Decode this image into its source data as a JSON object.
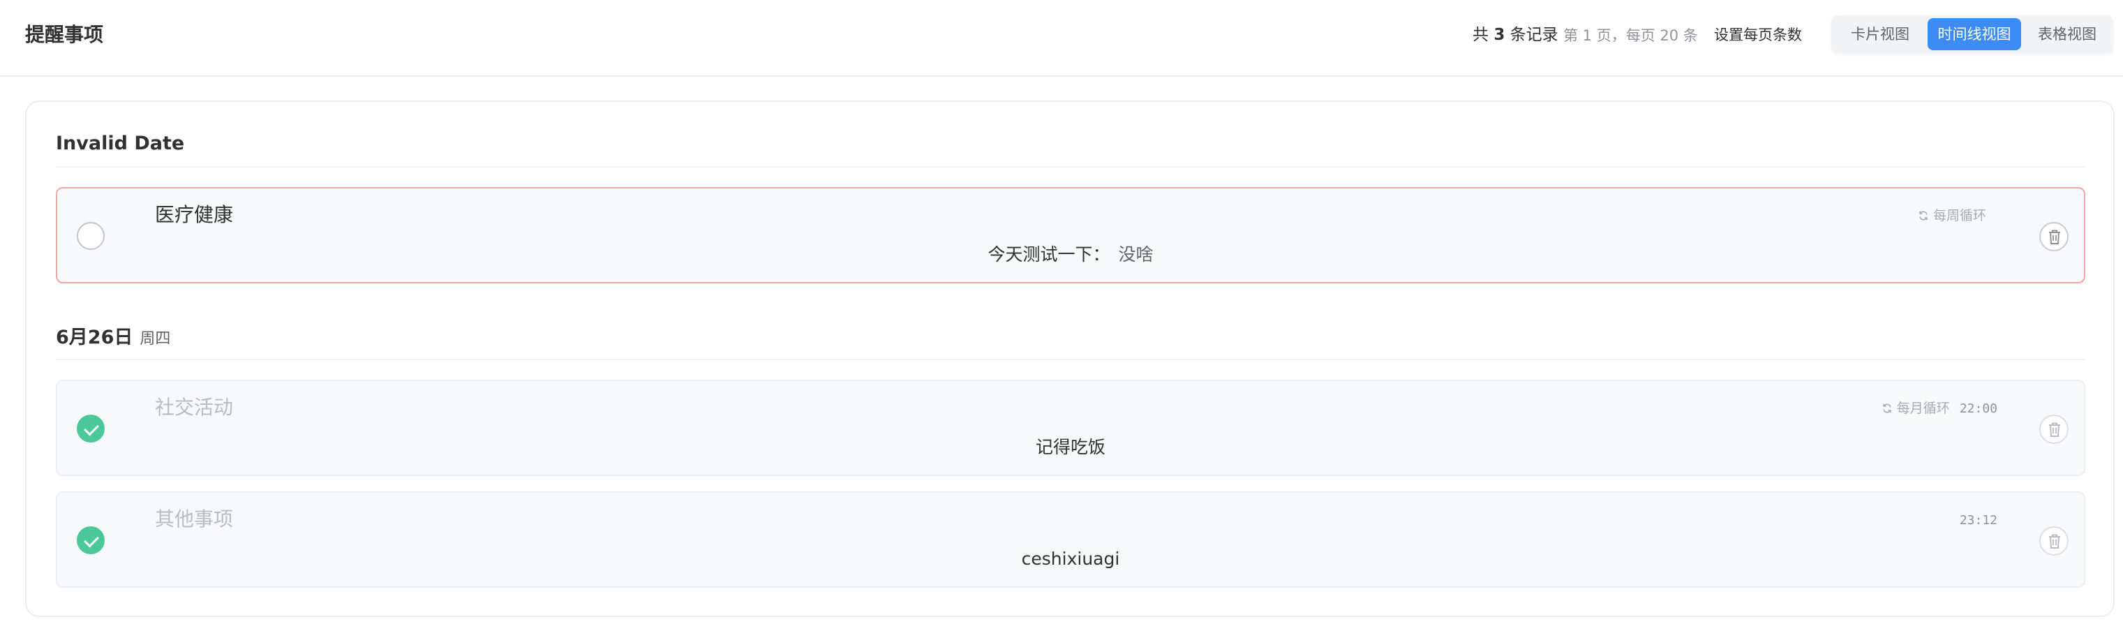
{
  "header": {
    "title": "提醒事项",
    "count_prefix": "共 ",
    "count_num": "3",
    "count_suffix": " 条记录",
    "pager_info": "第 1 页，每页 20 条",
    "set_page_size": "设置每页条数",
    "views": [
      {
        "label": "卡片视图",
        "active": false
      },
      {
        "label": "时间线视图",
        "active": true
      },
      {
        "label": "表格视图",
        "active": false
      }
    ]
  },
  "groups": [
    {
      "date": "Invalid Date",
      "weekday": "",
      "items": [
        {
          "title": "医疗健康",
          "desc_label": "今天测试一下：",
          "desc_value": "没啥",
          "repeat": "每周循环",
          "time": "",
          "completed": false,
          "overdue": true
        }
      ]
    },
    {
      "date": "6月26日",
      "weekday": "周四",
      "items": [
        {
          "title": "社交活动",
          "desc_label": "记得吃饭",
          "desc_value": "",
          "repeat": "每月循环",
          "time": "22:00",
          "completed": true,
          "overdue": false
        },
        {
          "title": "其他事项",
          "desc_label": "ceshixiuagi",
          "desc_value": "",
          "repeat": "",
          "time": "23:12",
          "completed": true,
          "overdue": false
        }
      ]
    }
  ],
  "colors": {
    "accent": "#3d8bf5",
    "done": "#4cc79a",
    "overdue_border": "#f4a5a5"
  },
  "icons": {
    "check": "check-icon",
    "repeat": "repeat-icon",
    "delete": "trash-icon"
  }
}
